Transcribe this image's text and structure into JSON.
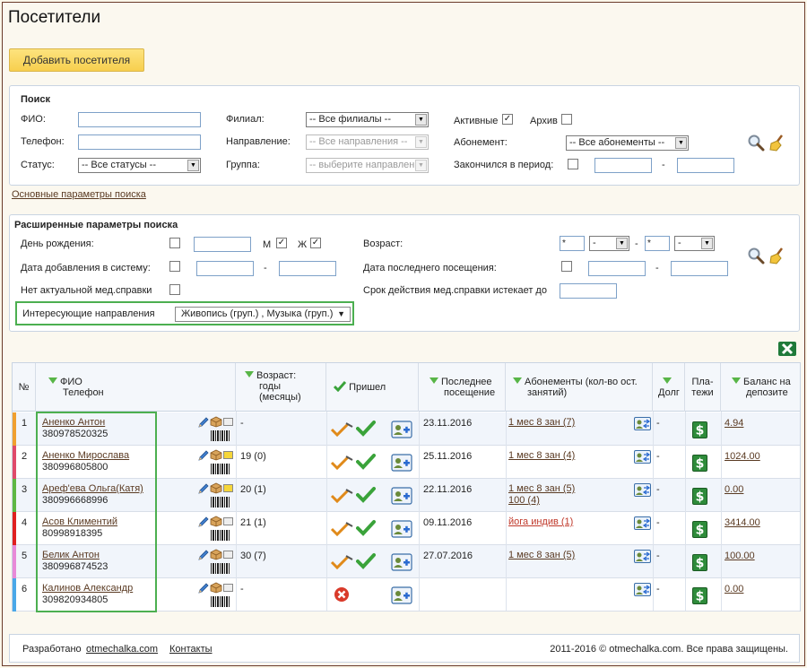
{
  "page": {
    "title": "Посетители",
    "add_button": "Добавить посетителя"
  },
  "search": {
    "title": "Поиск",
    "fio_label": "ФИО:",
    "phone_label": "Телефон:",
    "status_label": "Статус:",
    "status_value": "-- Все статусы --",
    "branch_label": "Филиал:",
    "branch_value": "-- Все филиалы --",
    "direction_label": "Направление:",
    "direction_value": "-- Все направления --",
    "group_label": "Группа:",
    "group_value": "-- выберите направление --",
    "active_label": "Активные",
    "archive_label": "Архив",
    "subscription_label": "Абонемент:",
    "subscription_value": "-- Все абонементы --",
    "ended_label": "Закончился в период:",
    "dash": "-",
    "basic_link": "Основные параметры поиска",
    "search_icon": "magnifier-icon",
    "clear_icon": "broom-icon"
  },
  "advanced": {
    "title": "Расширенные параметры поиска",
    "birthday_label": "День рождения:",
    "male_label": "М",
    "female_label": "Ж",
    "added_label": "Дата добавления в систему:",
    "no_med_label": "Нет актуальной мед.справки",
    "interests_label": "Интересующие направления",
    "interests_value": "Живопись (груп.) , Музыка (груп.)",
    "age_label": "Возраст:",
    "age_from": "*",
    "age_to": "*",
    "age_sel1": "-",
    "age_sel2": "-",
    "last_visit_label": "Дата последнего посещения:",
    "med_expire_label": "Срок действия мед.справки истекает до",
    "dash": "-"
  },
  "table": {
    "excel_icon": "excel-export-icon",
    "headers": {
      "num": "№",
      "name_l1": "ФИО",
      "name_l2": "Телефон",
      "age_l1": "Возраст:",
      "age_l2": "годы",
      "age_l3": "(месяцы)",
      "came": "Пришел",
      "last_l1": "Последнее",
      "last_l2": "посещение",
      "subs_l1": "Абонементы (кол-во ост.",
      "subs_l2": "занятий)",
      "debt": "Долг",
      "pay_l1": "Пла-",
      "pay_l2": "тежи",
      "bal_l1": "Баланс на",
      "bal_l2": "депозите"
    },
    "rows": [
      {
        "num": "1",
        "name": "Аненко Антон",
        "phone": "380978520325",
        "age": "-",
        "last": "23.11.2016",
        "sub1": "1 мес 8 зан (7)",
        "sub2": "",
        "debt": "-",
        "balance": "4.94",
        "color": "#f0a030"
      },
      {
        "num": "2",
        "name": "Аненко Мирослава",
        "phone": "380996805800",
        "age": "19 (0)",
        "last": "25.11.2016",
        "sub1": "1 мес 8 зан (4)",
        "sub2": "",
        "debt": "-",
        "balance": "1024.00",
        "color": "#e04a6a"
      },
      {
        "num": "3",
        "name": "Ареф'ева Ольга(Катя)",
        "phone": "380996668996",
        "age": "20 (1)",
        "last": "22.11.2016",
        "sub1": "1 мес 8 зан (5)",
        "sub2": "100 (4)",
        "debt": "-",
        "balance": "0.00",
        "color": "#5fb843"
      },
      {
        "num": "4",
        "name": "Асов Климентий",
        "phone": "80998918395",
        "age": "21 (1)",
        "last": "09.11.2016",
        "sub1": "йога индив (1)",
        "sub2": "",
        "debt": "-",
        "balance": "3414.00",
        "color": "#e02020"
      },
      {
        "num": "5",
        "name": "Белик Антон",
        "phone": "380996874523",
        "age": "30 (7)",
        "last": "27.07.2016",
        "sub1": "1 мес 8 зан (5)",
        "sub2": "",
        "debt": "-",
        "balance": "100.00",
        "color": "#e88ad8"
      },
      {
        "num": "6",
        "name": "Калинов Александр",
        "phone": "309820934805",
        "age": "-",
        "last": "",
        "sub1": "",
        "sub2": "",
        "debt": "-",
        "balance": "0.00",
        "color": "#4aa8e8"
      }
    ]
  },
  "footer": {
    "made_by": "Разработано",
    "site_link": "otmechalka.com",
    "contacts": "Контакты",
    "copyright": "2011-2016 © otmechalka.com. Все права защищены."
  }
}
